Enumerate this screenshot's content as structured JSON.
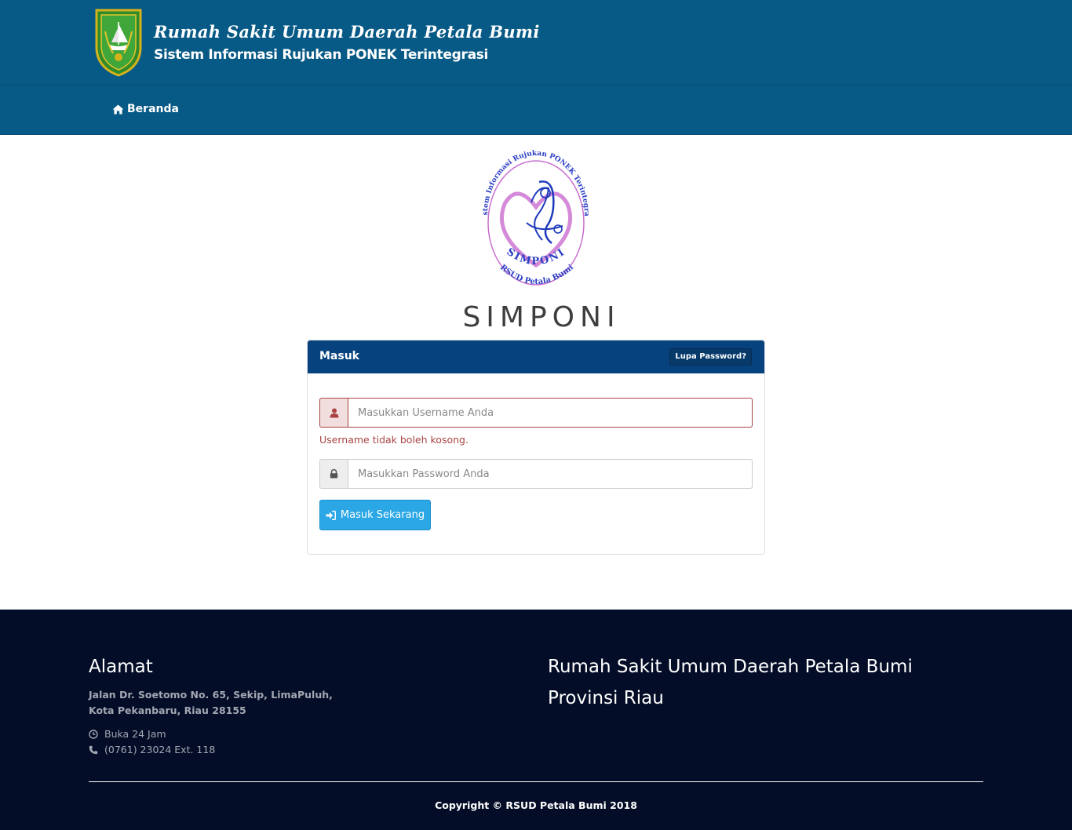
{
  "header": {
    "title": "Rumah Sakit Umum Daerah Petala Bumi",
    "subtitle": "Sistem Informasi Rujukan PONEK Terintegrasi",
    "crest_icon": "riau-crest-icon",
    "brand_color": "#085a86"
  },
  "nav": {
    "home_label": "Beranda",
    "home_icon": "home-icon"
  },
  "logo": {
    "ring_text": "Sistem Informasi Rujukan PONEK Terintegrasi",
    "inner_text": "SIMPONI",
    "bottom_text": "RSUD Petala Bumi",
    "app_name": "SIMPONI"
  },
  "login": {
    "panel_title": "Masuk",
    "forgot_label": "Lupa Password?",
    "username_placeholder": "Masukkan Username Anda",
    "username_value": "",
    "username_error": "Username tidak boleh kosong.",
    "password_placeholder": "Masukkan Password Anda",
    "password_value": "",
    "submit_label": "Masuk Sekarang",
    "header_color": "#06437e",
    "button_color": "#2ba7e6",
    "error_color": "#a94442"
  },
  "footer": {
    "address_title": "Alamat",
    "address_line1": "Jalan Dr. Soetomo No. 65, Sekip, LimaPuluh,",
    "address_line2": "Kota Pekanbaru, Riau 28155",
    "hours": "Buka 24 Jam",
    "phone": "(0761) 23024  Ext. 118",
    "org_line1": "Rumah Sakit Umum Daerah Petala Bumi",
    "org_line2": "Provinsi Riau",
    "copyright": "Copyright © RSUD Petala Bumi 2018",
    "background": "#040d27"
  }
}
